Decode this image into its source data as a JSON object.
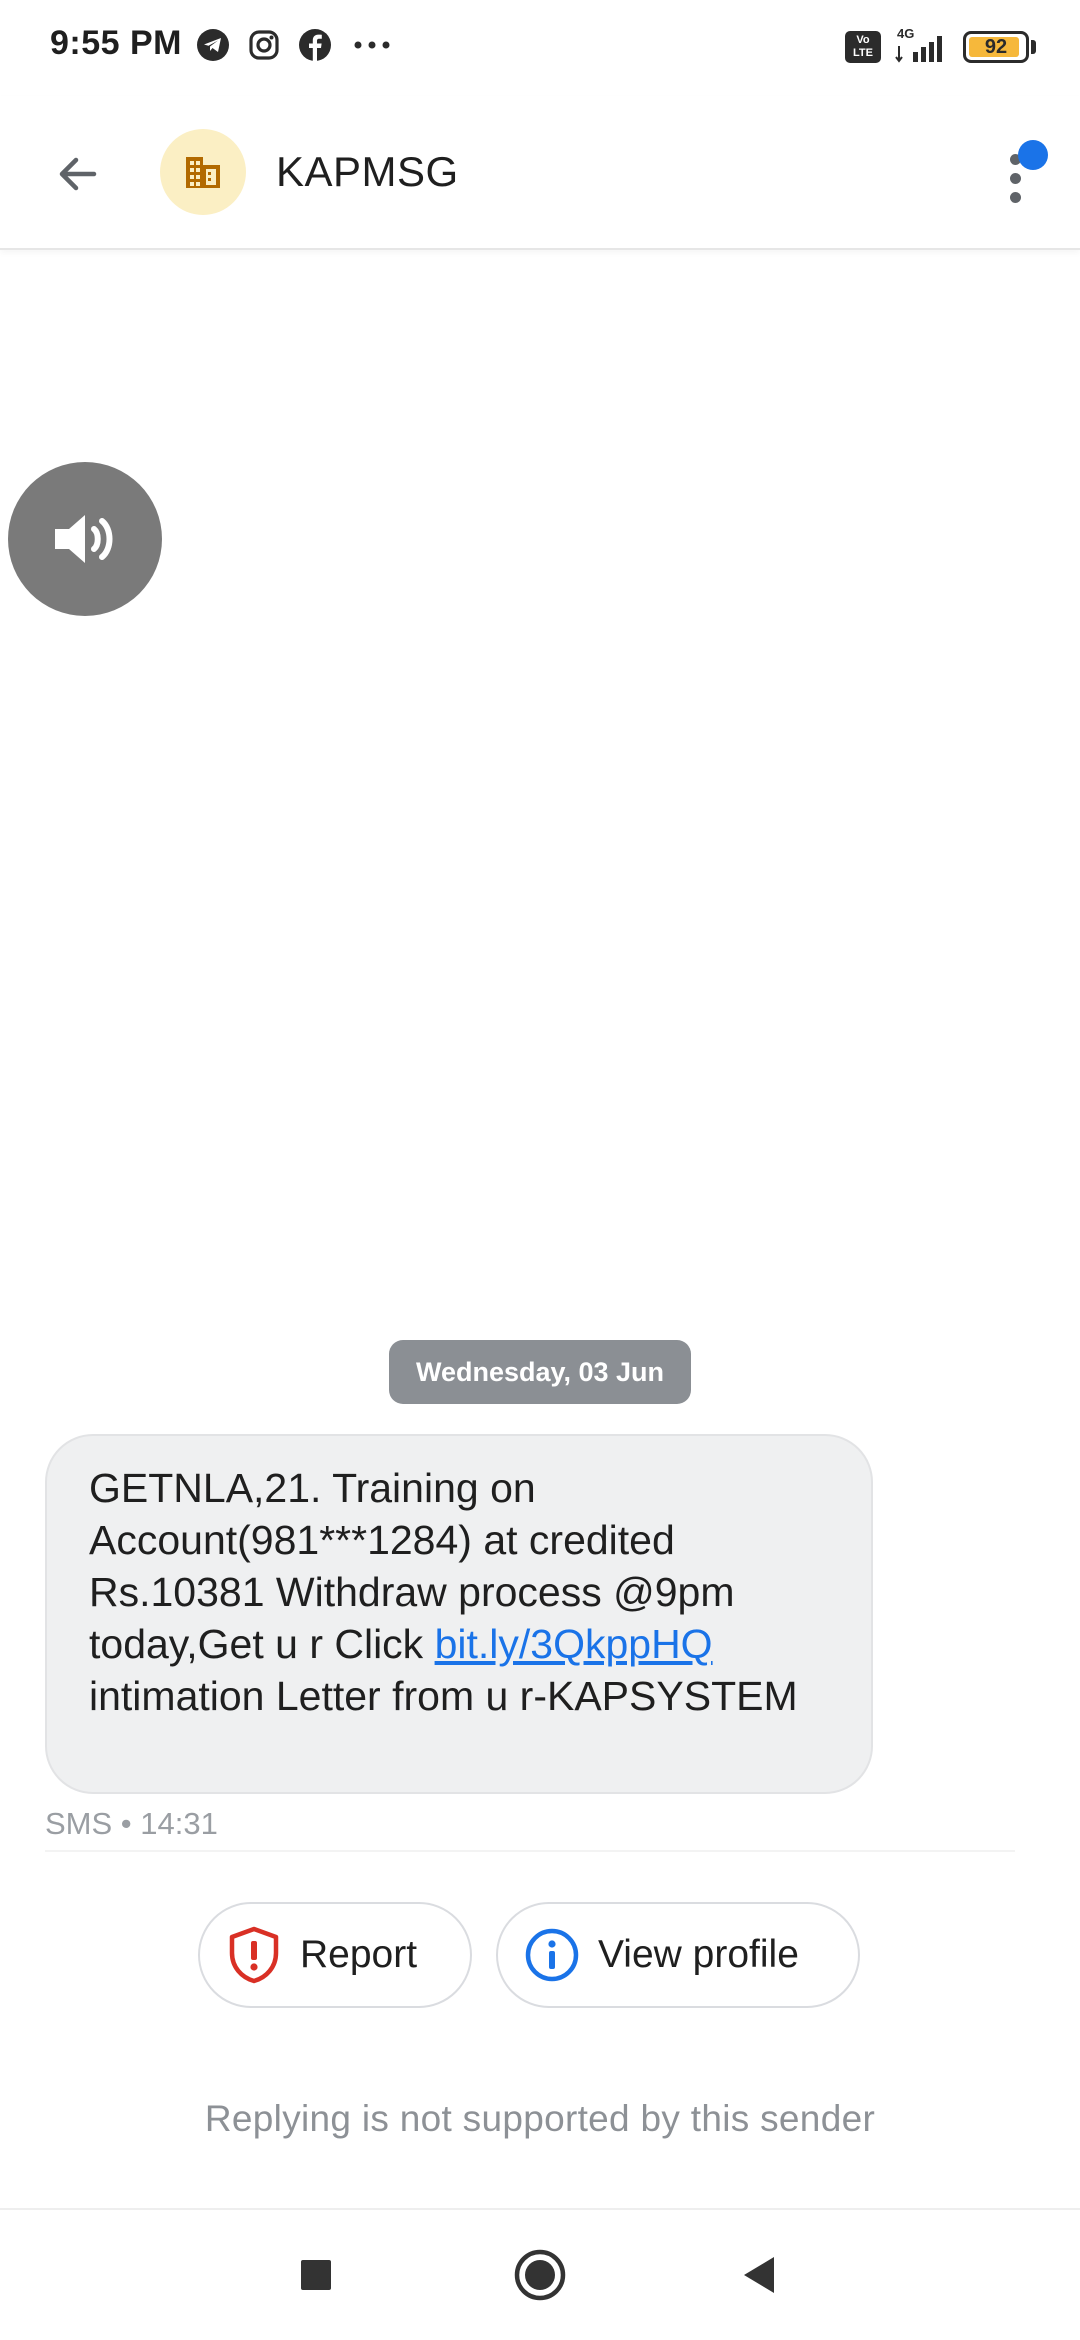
{
  "status_bar": {
    "time": "9:55 PM",
    "left_icons": [
      "telegram-icon",
      "instagram-icon",
      "facebook-icon",
      "more-notifications-icon"
    ],
    "volte_label": "Vo LTE",
    "network_label": "4G",
    "battery_level": "92",
    "battery_fraction": 0.92
  },
  "app_bar": {
    "contact_name": "KAPMSG",
    "avatar_icon": "business-icon",
    "avatar_bg": "#fbefc4",
    "avatar_icon_color": "#b26a00",
    "notify_color": "#1a73e8"
  },
  "conversation": {
    "date_chip": "Wednesday, 03 Jun",
    "message": {
      "text_before_link": "GETNLA,21. Training on Account(981***1284) at credited Rs.10381 Withdraw process @9pm today,Get u r Click ",
      "link": "bit.ly/3QkppHQ",
      "text_after_link": " intimation Letter from u r-KAPSYSTEM",
      "meta": "SMS • 14:31"
    }
  },
  "actions": {
    "report_label": "Report",
    "view_profile_label": "View profile"
  },
  "footer": {
    "reply_note": "Replying is not supported by this sender"
  },
  "colors": {
    "accent": "#1a73e8",
    "report_red": "#d93025",
    "bubble_bg": "#eff0f1",
    "date_chip_bg": "#8b8f94"
  }
}
